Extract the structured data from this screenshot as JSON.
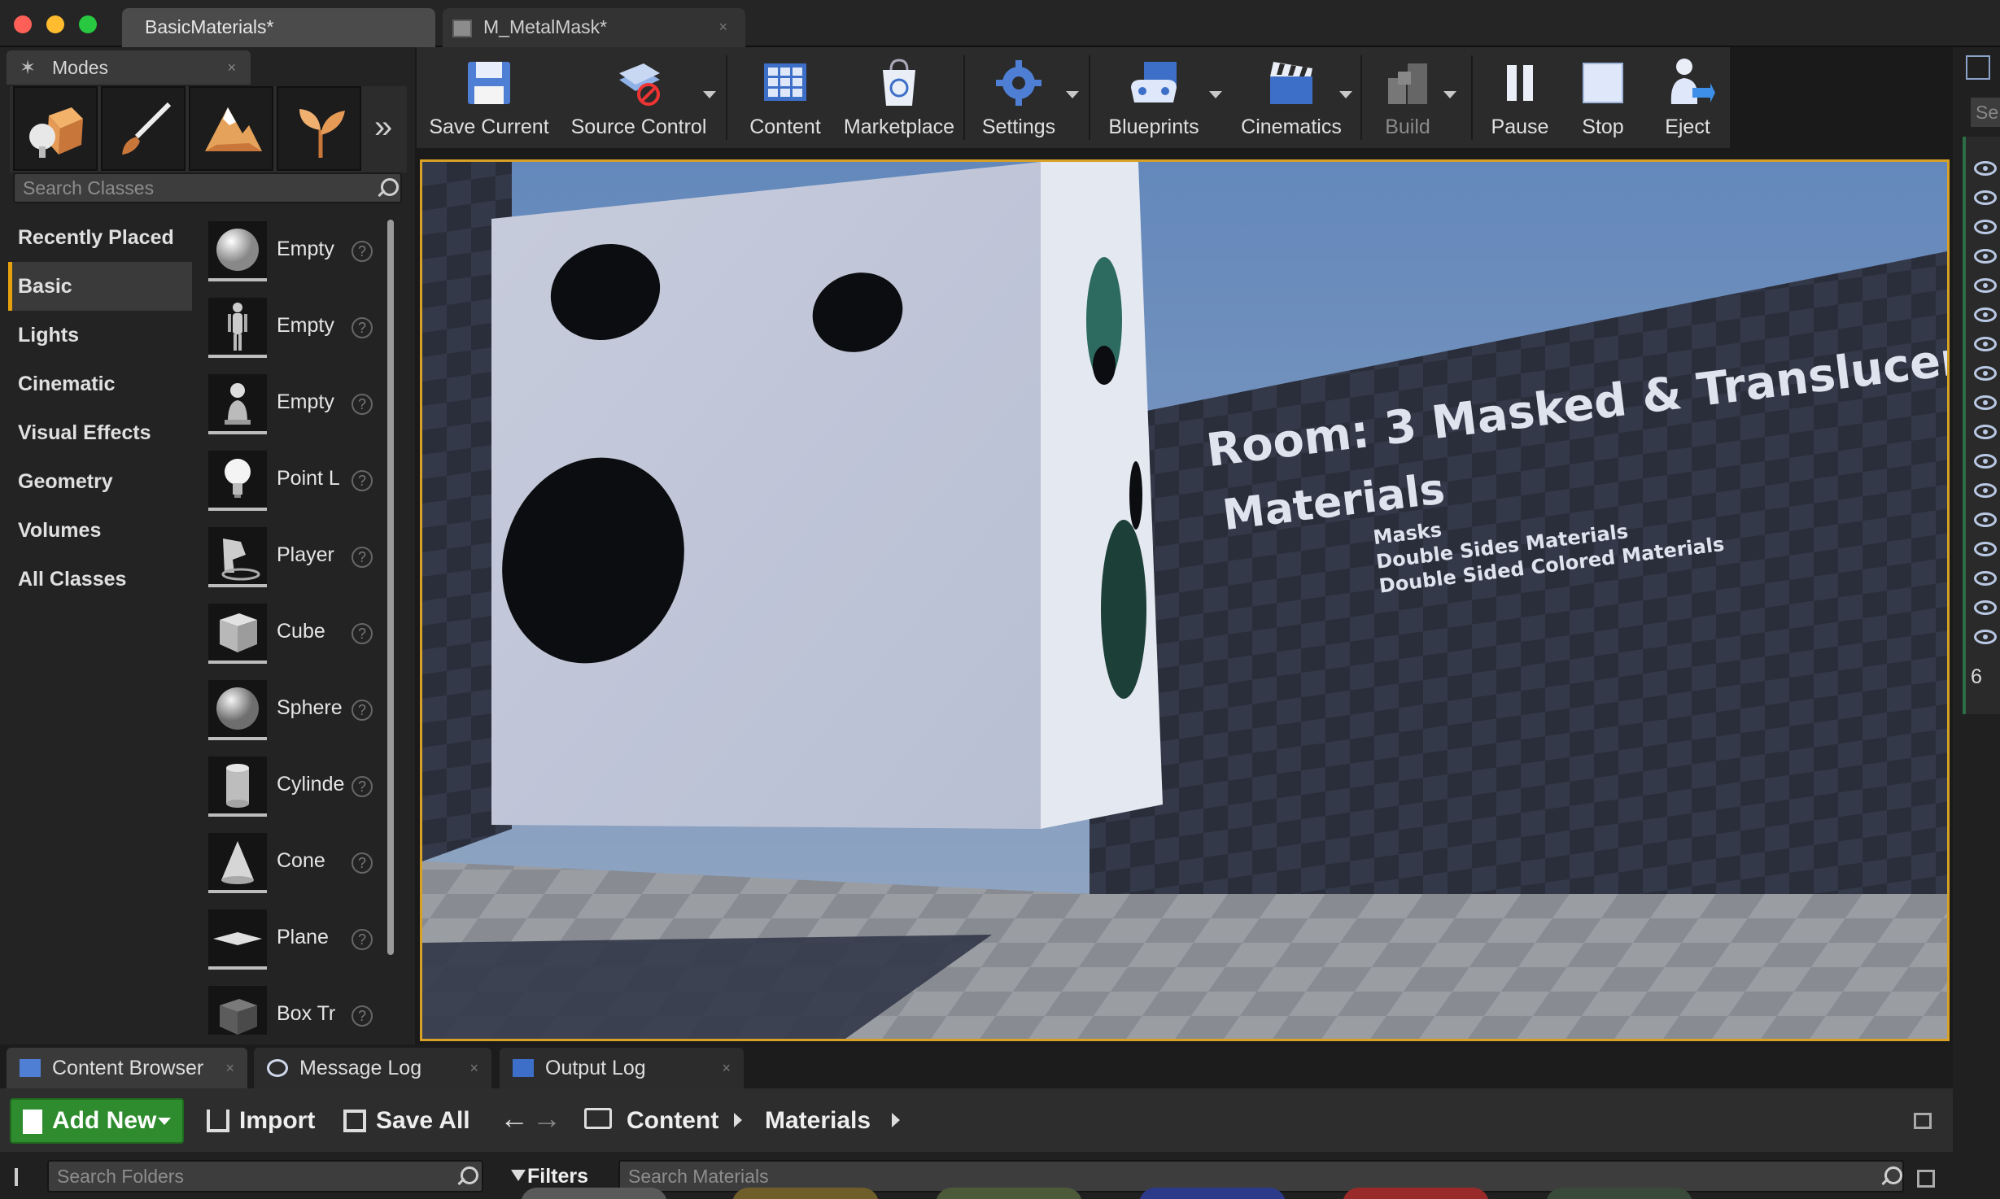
{
  "window": {
    "tabs": [
      {
        "label": "BasicMaterials*"
      },
      {
        "label": "M_MetalMask*"
      }
    ],
    "close_glyph": "×"
  },
  "modes": {
    "tab_label": "Modes",
    "tool_icons": [
      "place-mode-icon",
      "paint-mode-icon",
      "landscape-mode-icon",
      "foliage-mode-icon"
    ],
    "expand_glyph": "»",
    "search_placeholder": "Search Classes",
    "categories": [
      "Recently Placed",
      "Basic",
      "Lights",
      "Cinematic",
      "Visual Effects",
      "Geometry",
      "Volumes",
      "All Classes"
    ],
    "active_category": "Basic",
    "items": [
      {
        "label": "Empty",
        "icon": "sphere-icon"
      },
      {
        "label": "Empty",
        "icon": "character-icon"
      },
      {
        "label": "Empty",
        "icon": "pawn-icon"
      },
      {
        "label": "Point L",
        "icon": "bulb-icon"
      },
      {
        "label": "Player",
        "icon": "player-start-icon"
      },
      {
        "label": "Cube",
        "icon": "cube-icon"
      },
      {
        "label": "Sphere",
        "icon": "sphere-icon"
      },
      {
        "label": "Cylinde",
        "icon": "cylinder-icon"
      },
      {
        "label": "Cone",
        "icon": "cone-icon"
      },
      {
        "label": "Plane",
        "icon": "plane-icon"
      },
      {
        "label": "Box Tr",
        "icon": "box-trigger-icon"
      }
    ],
    "help_glyph": "?"
  },
  "toolbar": {
    "buttons": [
      {
        "label": "Save Current",
        "icon": "save-icon"
      },
      {
        "label": "Source Control",
        "icon": "source-control-icon"
      },
      {
        "label": "Content",
        "icon": "content-icon"
      },
      {
        "label": "Marketplace",
        "icon": "marketplace-icon"
      },
      {
        "label": "Settings",
        "icon": "settings-icon"
      },
      {
        "label": "Blueprints",
        "icon": "blueprints-icon"
      },
      {
        "label": "Cinematics",
        "icon": "cinematics-icon"
      },
      {
        "label": "Build",
        "icon": "build-icon"
      },
      {
        "label": "Pause",
        "icon": "pause-icon"
      },
      {
        "label": "Stop",
        "icon": "stop-icon"
      },
      {
        "label": "Eject",
        "icon": "eject-icon"
      }
    ]
  },
  "viewport": {
    "sign_title_line1": "Room: 3 Masked & Translucen",
    "sign_title_line2": "Materials",
    "sign_list": [
      "Masks",
      "Double Sides Materials",
      "Double Sided Colored Materials"
    ],
    "colors": {
      "sky": "#7fa6d6",
      "cube": "#c9cfe0",
      "wall": "#2b2f3d",
      "floor": "#8b8e93"
    }
  },
  "right_panel": {
    "search_stub": "Se",
    "count_stub": "6"
  },
  "bottom": {
    "tabs": [
      {
        "label": "Content Browser"
      },
      {
        "label": "Message Log"
      },
      {
        "label": "Output Log"
      }
    ],
    "add_new": "Add New",
    "import": "Import",
    "save_all": "Save All",
    "breadcrumbs": [
      "Content",
      "Materials"
    ],
    "folders_placeholder": "Search Folders",
    "filters": "Filters",
    "materials_placeholder": "Search Materials"
  }
}
